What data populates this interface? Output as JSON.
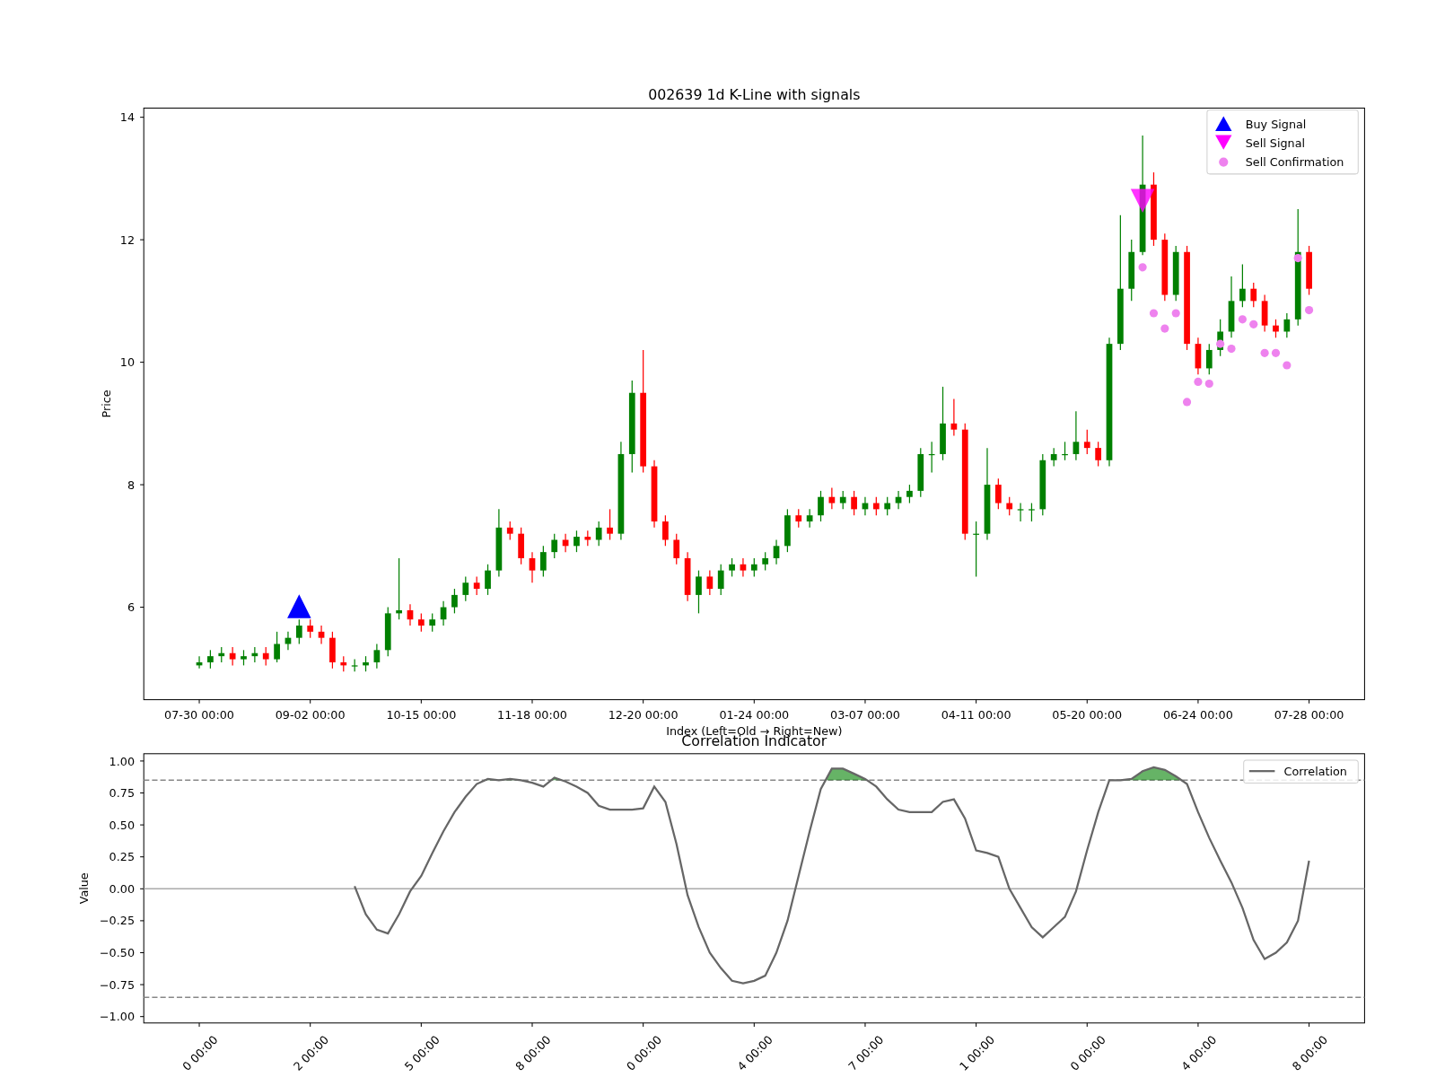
{
  "price_chart": {
    "chart_data": {
      "type": "candlestick",
      "title": "002639 1d K-Line with signals",
      "xlabel": "Index (Left=Old → Right=New)",
      "ylabel": "Price",
      "categories": [
        "07-30 00:00",
        null,
        null,
        null,
        null,
        null,
        null,
        null,
        null,
        null,
        "09-02 00:00",
        null,
        null,
        null,
        null,
        null,
        null,
        null,
        null,
        null,
        "10-15 00:00",
        null,
        null,
        null,
        null,
        null,
        null,
        null,
        null,
        null,
        "11-18 00:00",
        null,
        null,
        null,
        null,
        null,
        null,
        null,
        null,
        null,
        "12-20 00:00",
        null,
        null,
        null,
        null,
        null,
        null,
        null,
        null,
        null,
        "01-24 00:00",
        null,
        null,
        null,
        null,
        null,
        null,
        null,
        null,
        null,
        "03-07 00:00",
        null,
        null,
        null,
        null,
        null,
        null,
        null,
        null,
        null,
        "04-11 00:00",
        null,
        null,
        null,
        null,
        null,
        null,
        null,
        null,
        null,
        "05-20 00:00",
        null,
        null,
        null,
        null,
        null,
        null,
        null,
        null,
        null,
        "06-24 00:00",
        null,
        null,
        null,
        null,
        null,
        null,
        null,
        null,
        null,
        "07-28 00:00"
      ],
      "ylim": [
        4.49,
        14.15
      ],
      "yticks": [
        6,
        8,
        10,
        12,
        14
      ],
      "legend": "upper right",
      "ohlc": [
        [
          5.05,
          5.2,
          5.0,
          5.1
        ],
        [
          5.1,
          5.3,
          5.0,
          5.2
        ],
        [
          5.2,
          5.35,
          5.1,
          5.25
        ],
        [
          5.25,
          5.35,
          5.05,
          5.15
        ],
        [
          5.15,
          5.3,
          5.05,
          5.2
        ],
        [
          5.2,
          5.35,
          5.1,
          5.25
        ],
        [
          5.25,
          5.35,
          5.05,
          5.15
        ],
        [
          5.15,
          5.6,
          5.1,
          5.4
        ],
        [
          5.4,
          5.6,
          5.3,
          5.5
        ],
        [
          5.5,
          5.8,
          5.4,
          5.7
        ],
        [
          5.7,
          5.8,
          5.5,
          5.6
        ],
        [
          5.6,
          5.7,
          5.4,
          5.5
        ],
        [
          5.5,
          5.6,
          5.0,
          5.1
        ],
        [
          5.1,
          5.2,
          4.95,
          5.05
        ],
        [
          5.05,
          5.15,
          4.95,
          5.05
        ],
        [
          5.05,
          5.2,
          4.95,
          5.1
        ],
        [
          5.1,
          5.4,
          5.0,
          5.3
        ],
        [
          5.3,
          6.0,
          5.2,
          5.9
        ],
        [
          5.9,
          6.8,
          5.8,
          5.95
        ],
        [
          5.95,
          6.05,
          5.7,
          5.8
        ],
        [
          5.8,
          5.9,
          5.6,
          5.7
        ],
        [
          5.7,
          5.9,
          5.6,
          5.8
        ],
        [
          5.8,
          6.1,
          5.7,
          6.0
        ],
        [
          6.0,
          6.3,
          5.9,
          6.2
        ],
        [
          6.2,
          6.5,
          6.1,
          6.4
        ],
        [
          6.4,
          6.5,
          6.2,
          6.3
        ],
        [
          6.3,
          6.7,
          6.2,
          6.6
        ],
        [
          6.6,
          7.6,
          6.5,
          7.3
        ],
        [
          7.3,
          7.4,
          7.1,
          7.2
        ],
        [
          7.2,
          7.3,
          6.7,
          6.8
        ],
        [
          6.8,
          6.9,
          6.4,
          6.6
        ],
        [
          6.6,
          7.0,
          6.5,
          6.9
        ],
        [
          6.9,
          7.2,
          6.8,
          7.1
        ],
        [
          7.1,
          7.2,
          6.9,
          7.0
        ],
        [
          7.0,
          7.25,
          6.9,
          7.15
        ],
        [
          7.15,
          7.25,
          7.0,
          7.1
        ],
        [
          7.1,
          7.4,
          7.0,
          7.3
        ],
        [
          7.3,
          7.6,
          7.1,
          7.2
        ],
        [
          7.2,
          8.7,
          7.1,
          8.5
        ],
        [
          8.5,
          9.7,
          8.2,
          9.5
        ],
        [
          9.5,
          10.2,
          8.2,
          8.3
        ],
        [
          8.3,
          8.4,
          7.3,
          7.4
        ],
        [
          7.4,
          7.5,
          7.0,
          7.1
        ],
        [
          7.1,
          7.2,
          6.7,
          6.8
        ],
        [
          6.8,
          6.9,
          6.1,
          6.2
        ],
        [
          6.2,
          6.6,
          5.9,
          6.5
        ],
        [
          6.5,
          6.6,
          6.2,
          6.3
        ],
        [
          6.3,
          6.7,
          6.2,
          6.6
        ],
        [
          6.6,
          6.8,
          6.5,
          6.7
        ],
        [
          6.7,
          6.8,
          6.5,
          6.6
        ],
        [
          6.6,
          6.8,
          6.5,
          6.7
        ],
        [
          6.7,
          6.9,
          6.6,
          6.8
        ],
        [
          6.8,
          7.1,
          6.7,
          7.0
        ],
        [
          7.0,
          7.6,
          6.9,
          7.5
        ],
        [
          7.5,
          7.6,
          7.3,
          7.4
        ],
        [
          7.4,
          7.6,
          7.3,
          7.5
        ],
        [
          7.5,
          7.9,
          7.4,
          7.8
        ],
        [
          7.8,
          7.95,
          7.6,
          7.7
        ],
        [
          7.7,
          7.9,
          7.6,
          7.8
        ],
        [
          7.8,
          7.9,
          7.5,
          7.6
        ],
        [
          7.6,
          7.8,
          7.5,
          7.7
        ],
        [
          7.7,
          7.8,
          7.5,
          7.6
        ],
        [
          7.6,
          7.8,
          7.5,
          7.7
        ],
        [
          7.7,
          7.9,
          7.6,
          7.8
        ],
        [
          7.8,
          8.0,
          7.7,
          7.9
        ],
        [
          7.9,
          8.6,
          7.8,
          8.5
        ],
        [
          8.5,
          8.7,
          8.2,
          8.5
        ],
        [
          8.5,
          9.6,
          8.4,
          9.0
        ],
        [
          9.0,
          9.4,
          8.8,
          8.9
        ],
        [
          8.9,
          9.0,
          7.1,
          7.2
        ],
        [
          7.2,
          7.4,
          6.5,
          7.2
        ],
        [
          7.2,
          8.6,
          7.1,
          8.0
        ],
        [
          8.0,
          8.1,
          7.6,
          7.7
        ],
        [
          7.7,
          7.8,
          7.5,
          7.6
        ],
        [
          7.6,
          7.7,
          7.4,
          7.6
        ],
        [
          7.6,
          7.7,
          7.4,
          7.6
        ],
        [
          7.6,
          8.5,
          7.5,
          8.4
        ],
        [
          8.4,
          8.6,
          8.3,
          8.5
        ],
        [
          8.5,
          8.7,
          8.4,
          8.5
        ],
        [
          8.5,
          9.2,
          8.4,
          8.7
        ],
        [
          8.7,
          8.9,
          8.5,
          8.6
        ],
        [
          8.6,
          8.7,
          8.3,
          8.4
        ],
        [
          8.4,
          10.4,
          8.3,
          10.3
        ],
        [
          10.3,
          12.4,
          10.2,
          11.2
        ],
        [
          11.2,
          12.0,
          11.0,
          11.8
        ],
        [
          11.8,
          13.7,
          11.75,
          12.9
        ],
        [
          12.9,
          13.1,
          11.9,
          12.0
        ],
        [
          12.0,
          12.1,
          11.0,
          11.1
        ],
        [
          11.1,
          11.9,
          11.0,
          11.8
        ],
        [
          11.8,
          11.9,
          10.2,
          10.3
        ],
        [
          10.3,
          10.4,
          9.8,
          9.9
        ],
        [
          9.9,
          10.3,
          9.8,
          10.2
        ],
        [
          10.2,
          10.7,
          10.1,
          10.5
        ],
        [
          10.5,
          11.4,
          10.4,
          11.0
        ],
        [
          11.0,
          11.6,
          10.9,
          11.2
        ],
        [
          11.2,
          11.3,
          10.9,
          11.0
        ],
        [
          11.0,
          11.1,
          10.5,
          10.6
        ],
        [
          10.6,
          10.7,
          10.4,
          10.5
        ],
        [
          10.5,
          10.8,
          10.4,
          10.7
        ],
        [
          10.7,
          12.5,
          10.6,
          11.8
        ],
        [
          11.8,
          11.9,
          11.1,
          11.2
        ]
      ],
      "series": [
        {
          "name": "Buy Signal",
          "type": "scatter",
          "marker": "^",
          "color": "#0000ff",
          "values": [
            null,
            null,
            null,
            null,
            null,
            null,
            null,
            null,
            null,
            6.0,
            null,
            null,
            null,
            null,
            null,
            null,
            null,
            null,
            null,
            null,
            null,
            null,
            null,
            null,
            null,
            null,
            null,
            null,
            null,
            null,
            null,
            null,
            null,
            null,
            null,
            null,
            null,
            null,
            null,
            null,
            null,
            null,
            null,
            null,
            null,
            null,
            null,
            null,
            null,
            null,
            null,
            null,
            null,
            null,
            null,
            null,
            null,
            null,
            null,
            null,
            null,
            null,
            null,
            null,
            null,
            null,
            null,
            null,
            null,
            null,
            null,
            null,
            null,
            null,
            null,
            null,
            null,
            null,
            null,
            null,
            null,
            null,
            null,
            null,
            null,
            null,
            null,
            null,
            null,
            null,
            null,
            null,
            null,
            null,
            null,
            null,
            null,
            null,
            null,
            null,
            null
          ]
        },
        {
          "name": "Sell Signal",
          "type": "scatter",
          "marker": "v",
          "color": "#ff00ff",
          "values": [
            null,
            null,
            null,
            null,
            null,
            null,
            null,
            null,
            null,
            null,
            null,
            null,
            null,
            null,
            null,
            null,
            null,
            null,
            null,
            null,
            null,
            null,
            null,
            null,
            null,
            null,
            null,
            null,
            null,
            null,
            null,
            null,
            null,
            null,
            null,
            null,
            null,
            null,
            null,
            null,
            null,
            null,
            null,
            null,
            null,
            null,
            null,
            null,
            null,
            null,
            null,
            null,
            null,
            null,
            null,
            null,
            null,
            null,
            null,
            null,
            null,
            null,
            null,
            null,
            null,
            null,
            null,
            null,
            null,
            null,
            null,
            null,
            null,
            null,
            null,
            null,
            null,
            null,
            null,
            null,
            null,
            null,
            null,
            null,
            null,
            12.65,
            null,
            null,
            null,
            null,
            null,
            null,
            null,
            null,
            null,
            null,
            null,
            null,
            null,
            null,
            null
          ]
        },
        {
          "name": "Sell Confirmation",
          "type": "scatter",
          "marker": "o",
          "color": "#ee82ee",
          "values": [
            null,
            null,
            null,
            null,
            null,
            null,
            null,
            null,
            null,
            null,
            null,
            null,
            null,
            null,
            null,
            null,
            null,
            null,
            null,
            null,
            null,
            null,
            null,
            null,
            null,
            null,
            null,
            null,
            null,
            null,
            null,
            null,
            null,
            null,
            null,
            null,
            null,
            null,
            null,
            null,
            null,
            null,
            null,
            null,
            null,
            null,
            null,
            null,
            null,
            null,
            null,
            null,
            null,
            null,
            null,
            null,
            null,
            null,
            null,
            null,
            null,
            null,
            null,
            null,
            null,
            null,
            null,
            null,
            null,
            null,
            null,
            null,
            null,
            null,
            null,
            null,
            null,
            null,
            null,
            null,
            null,
            null,
            null,
            null,
            null,
            11.55,
            10.8,
            10.55,
            10.8,
            9.35,
            9.68,
            9.65,
            10.3,
            10.22,
            10.7,
            10.62,
            10.15,
            10.15,
            9.95,
            11.7,
            10.85
          ]
        }
      ]
    }
  },
  "correlation_chart": {
    "chart_data": {
      "type": "line",
      "title": "Correlation Indicator",
      "ylabel": "Value",
      "categories": [
        "0 00:00",
        null,
        null,
        null,
        null,
        null,
        null,
        null,
        null,
        null,
        "2 00:00",
        null,
        null,
        null,
        null,
        null,
        null,
        null,
        null,
        null,
        "5 00:00",
        null,
        null,
        null,
        null,
        null,
        null,
        null,
        null,
        null,
        "8 00:00",
        null,
        null,
        null,
        null,
        null,
        null,
        null,
        null,
        null,
        "0 00:00",
        null,
        null,
        null,
        null,
        null,
        null,
        null,
        null,
        null,
        "4 00:00",
        null,
        null,
        null,
        null,
        null,
        null,
        null,
        null,
        null,
        "7 00:00",
        null,
        null,
        null,
        null,
        null,
        null,
        null,
        null,
        null,
        "1 00:00",
        null,
        null,
        null,
        null,
        null,
        null,
        null,
        null,
        null,
        "0 00:00",
        null,
        null,
        null,
        null,
        null,
        null,
        null,
        null,
        null,
        "4 00:00",
        null,
        null,
        null,
        null,
        null,
        null,
        null,
        null,
        null,
        "8 00:00"
      ],
      "ylim": [
        -1.05,
        1.057
      ],
      "yticks": [
        {
          "value": 1,
          "label": "1.00"
        },
        {
          "value": 0.75,
          "label": "0.75"
        },
        {
          "value": 0.5,
          "label": "0.50"
        },
        {
          "value": 0.25,
          "label": "0.25"
        },
        {
          "value": 0,
          "label": "0.00"
        },
        {
          "value": -0.25,
          "label": "−0.25"
        },
        {
          "value": -0.5,
          "label": "−0.50"
        },
        {
          "value": -0.75,
          "label": "−0.75"
        },
        {
          "value": -1,
          "label": "−1.00"
        }
      ],
      "legend": "upper right",
      "ref_lines": [
        {
          "axis": "y",
          "value": 0.85,
          "color": "#888888"
        },
        {
          "axis": "y",
          "value": -0.85,
          "color": "#888888"
        },
        {
          "axis": "y",
          "value": 0,
          "color": "#aaaaaa"
        }
      ],
      "series": [
        {
          "name": "Correlation",
          "color": "#666666",
          "values": [
            null,
            null,
            null,
            null,
            null,
            null,
            null,
            null,
            null,
            null,
            null,
            null,
            null,
            null,
            0.02,
            -0.2,
            -0.32,
            -0.35,
            -0.2,
            -0.02,
            0.1,
            0.28,
            0.45,
            0.6,
            0.72,
            0.82,
            0.86,
            0.85,
            0.86,
            0.85,
            0.83,
            0.8,
            0.87,
            0.84,
            0.8,
            0.75,
            0.65,
            0.62,
            0.62,
            0.62,
            0.63,
            0.8,
            0.68,
            0.35,
            -0.05,
            -0.3,
            -0.5,
            -0.62,
            -0.72,
            -0.74,
            -0.72,
            -0.68,
            -0.5,
            -0.25,
            0.1,
            0.45,
            0.78,
            0.94,
            0.94,
            0.9,
            0.86,
            0.8,
            0.7,
            0.62,
            0.6,
            0.6,
            0.6,
            0.68,
            0.7,
            0.55,
            0.3,
            0.28,
            0.25,
            0.0,
            -0.15,
            -0.3,
            -0.38,
            -0.3,
            -0.22,
            -0.02,
            0.3,
            0.6,
            0.85,
            0.85,
            0.86,
            0.92,
            0.95,
            0.93,
            0.88,
            0.82,
            0.6,
            0.4,
            0.22,
            0.05,
            -0.15,
            -0.4,
            -0.55,
            -0.5,
            -0.42,
            -0.25,
            0.22
          ]
        }
      ]
    }
  }
}
